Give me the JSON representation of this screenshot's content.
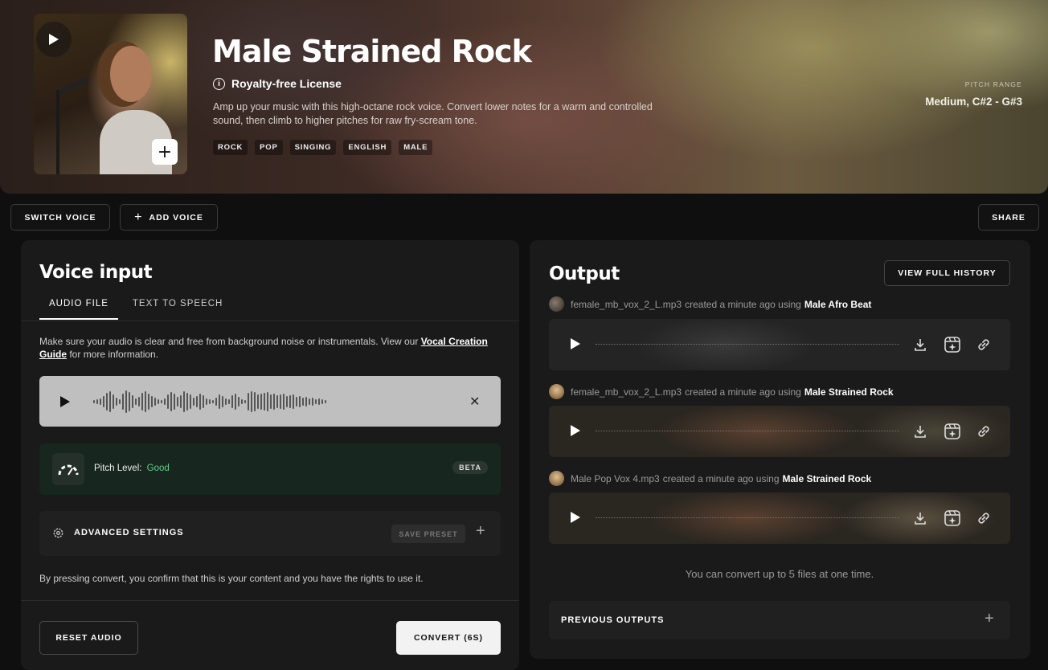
{
  "hero": {
    "title": "Male Strained Rock",
    "license": "Royalty-free License",
    "description": "Amp up your music with this high-octane rock voice. Convert lower notes for a warm and controlled sound, then climb to higher pitches for raw fry-scream tone.",
    "tags": [
      "ROCK",
      "POP",
      "SINGING",
      "ENGLISH",
      "MALE"
    ],
    "pitch_range_label": "PITCH RANGE",
    "pitch_range_value": "Medium, C#2 - G#3"
  },
  "toolbar": {
    "switch_voice": "SWITCH VOICE",
    "add_voice": "ADD VOICE",
    "share": "SHARE"
  },
  "voice_input": {
    "title": "Voice input",
    "tabs": [
      "AUDIO FILE",
      "TEXT TO SPEECH"
    ],
    "notice_prefix": "Make sure your audio is clear and free from background noise or instrumentals. View our ",
    "notice_link": "Vocal Creation Guide",
    "notice_suffix": " for more information.",
    "pitch_label": "Pitch Level:",
    "pitch_value": "Good",
    "beta": "BETA",
    "advanced_settings": "ADVANCED SETTINGS",
    "save_preset": "SAVE PRESET",
    "confirm_text": "By pressing convert, you confirm that this is your content and you have the rights to use it.",
    "reset_audio": "RESET AUDIO",
    "convert": "CONVERT (6S)"
  },
  "output": {
    "title": "Output",
    "view_history": "VIEW FULL HISTORY",
    "items": [
      {
        "file": "female_mb_vox_2_L.mp3",
        "middle": "created a minute ago using",
        "voice": "Male Afro Beat"
      },
      {
        "file": "female_mb_vox_2_L.mp3",
        "middle": "created a minute ago using",
        "voice": "Male Strained Rock"
      },
      {
        "file": "Male Pop Vox 4.mp3",
        "middle": "created a minute ago using",
        "voice": "Male Strained Rock"
      }
    ],
    "limit_note": "You can convert up to 5 files at one time.",
    "previous_outputs": "PREVIOUS OUTPUTS"
  }
}
